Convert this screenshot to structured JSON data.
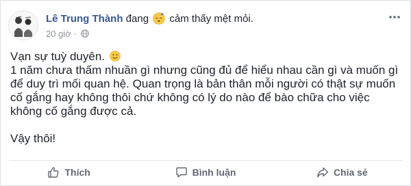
{
  "post": {
    "author": "Lê Trung Thành",
    "activity_prefix": "đang",
    "feeling_icon": "sleepy-face-icon",
    "feeling_text": "cảm thấy mệt mỏi.",
    "timestamp": "20 giờ",
    "privacy_icon": "globe-icon",
    "lines": [
      "Vạn sự tuỳ duyên.",
      "1 năm chưa thấm nhuần gì nhưng cũng đủ để hiểu nhau cần gì và muốn gì để duy trì mối quan hệ. Quan trọng là bản thân mỗi người có thật sự muốn cố gắng hay không thôi chứ không có lý do nào để bào chữa cho việc không cố gắng được cả.",
      "Vậy thôi!"
    ]
  },
  "actions": {
    "like_label": "Thích",
    "comment_label": "Bình luận",
    "share_label": "Chia sẻ"
  },
  "colors": {
    "author": "#365899",
    "text": "#1d2129",
    "meta": "#90949c",
    "action": "#606770"
  }
}
